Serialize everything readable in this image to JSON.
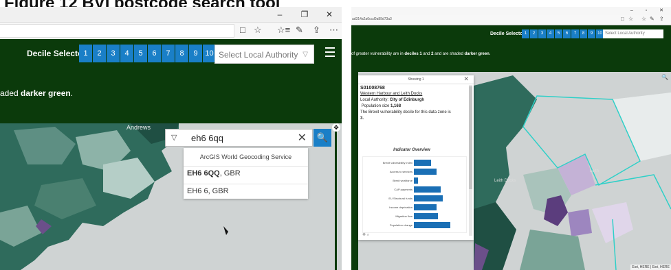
{
  "figure_title": "Figure 12 BVI postcode search tool",
  "left": {
    "window_controls": [
      "–",
      "❐",
      "✕"
    ],
    "toolbar_icons": [
      "□",
      "☆",
      "☆≡",
      "✎",
      "⇪",
      "⋯"
    ],
    "decile_label": "Decile Selector",
    "deciles": [
      "1",
      "2",
      "3",
      "4",
      "5",
      "6",
      "7",
      "8",
      "9",
      "10"
    ],
    "la_select": "Select Local Authority",
    "shade_prefix": "aded ",
    "shade_bold": "darker green",
    "shade_suffix": ".",
    "map_place": "Andrews",
    "search": {
      "value": "eh6 6qq",
      "clear": "✕",
      "button": "🔍"
    },
    "suggestions": {
      "header": "ArcGIS World Geocoding Service",
      "items": [
        {
          "bold": "EH6 6QQ",
          "rest": ", GBR"
        },
        {
          "bold": "",
          "rest": "EH6 6, GBR"
        }
      ]
    }
  },
  "right": {
    "address": "ad314a2a6ccd0a89d73a3",
    "decile_label": "Decile Selector",
    "deciles": [
      "1",
      "2",
      "3",
      "4",
      "5",
      "6",
      "7",
      "8",
      "9",
      "10"
    ],
    "la_select": "Select Local Authority",
    "desc_prefix": "of greater vulnerability are in ",
    "desc_b1": "deciles 1",
    "desc_mid": " and ",
    "desc_b2": "2",
    "desc_mid2": " and are shaded ",
    "desc_b3": "darker green",
    "desc_suffix": ".",
    "popup": {
      "header": "Showing 1",
      "close": "✕",
      "code": "S01008768",
      "area": "Western Harbour and Leith Docks",
      "la_label": "Local Authority: ",
      "la_value": "City of Edinburgh",
      "pop_label": "Population size ",
      "pop_value": "1,168",
      "decile_text": "The Brexit vulnerability decile for this data zone is",
      "decile_value": "3.",
      "indicator_title": "Indicator Overview",
      "tools": "✥  ⌕"
    },
    "map_labels": {
      "leith_docks": "Leith Docks",
      "leith": "Leith"
    },
    "attribution": "Esri, HERE | Esri, HERE"
  },
  "chart_data": {
    "type": "bar",
    "title": "Indicator Overview",
    "categories": [
      "Brexit vulnerability index",
      "Access to services",
      "Brexit workforce",
      "CAP payments",
      "EU Structural funds",
      "Income deprivation",
      "Migration flow",
      "Population change"
    ],
    "values": [
      0.42,
      0.55,
      0.1,
      0.65,
      0.7,
      0.55,
      0.58,
      0.88
    ],
    "xlim": [
      0,
      1
    ]
  },
  "colors": {
    "header": "#0b3a0b",
    "decile_blue": "#1a7fc7",
    "bar_blue": "#1a6fb5"
  }
}
